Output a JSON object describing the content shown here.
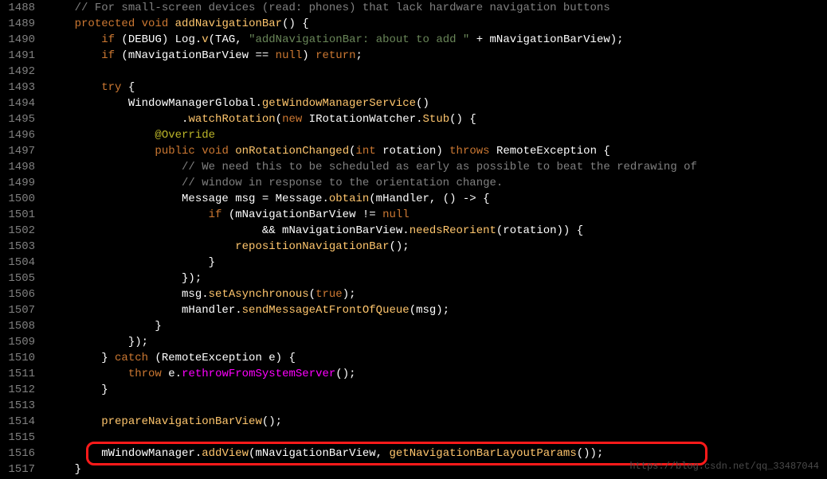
{
  "watermark": "https://blog.csdn.net/qq_33487044",
  "lines": [
    {
      "num": "1488",
      "html": "    <span class='comment'>// For small-screen devices (read: phones) that lack hardware navigation buttons</span>"
    },
    {
      "num": "1489",
      "html": "    <span class='kw-protected'>protected</span> <span class='kw-void'>void</span> <span class='method'>addNavigationBar</span>() {"
    },
    {
      "num": "1490",
      "html": "        <span class='kw-if'>if</span> (DEBUG) Log.<span class='method'>v</span>(TAG, <span class='string'>\"addNavigationBar: about to add \"</span> + mNavigationBarView);"
    },
    {
      "num": "1491",
      "html": "        <span class='kw-if'>if</span> (mNavigationBarView == <span class='lit-null'>null</span>) <span class='kw-return'>return</span>;"
    },
    {
      "num": "1492",
      "html": ""
    },
    {
      "num": "1493",
      "html": "        <span class='kw-try'>try</span> {"
    },
    {
      "num": "1494",
      "html": "            WindowManagerGlobal.<span class='method'>getWindowManagerService</span>()"
    },
    {
      "num": "1495",
      "html": "                    .<span class='method'>watchRotation</span>(<span class='kw-new'>new</span> IRotationWatcher.<span class='method'>Stub</span>() {"
    },
    {
      "num": "1496",
      "html": "                <span class='annotation'>@Override</span>"
    },
    {
      "num": "1497",
      "html": "                <span class='kw-public'>public</span> <span class='kw-void'>void</span> <span class='method'>onRotationChanged</span>(<span class='kw-int'>int</span> rotation) <span class='kw-throws'>throws</span> RemoteException {"
    },
    {
      "num": "1498",
      "html": "                    <span class='comment'>// We need this to be scheduled as early as possible to beat the redrawing of</span>"
    },
    {
      "num": "1499",
      "html": "                    <span class='comment'>// window in response to the orientation change.</span>"
    },
    {
      "num": "1500",
      "html": "                    Message msg = Message.<span class='method'>obtain</span>(mHandler, () -> {"
    },
    {
      "num": "1501",
      "html": "                        <span class='kw-if'>if</span> (mNavigationBarView != <span class='lit-null'>null</span>"
    },
    {
      "num": "1502",
      "html": "                                && mNavigationBarView.<span class='method'>needsReorient</span>(rotation)) {"
    },
    {
      "num": "1503",
      "html": "                            <span class='method'>repositionNavigationBar</span>();"
    },
    {
      "num": "1504",
      "html": "                        }"
    },
    {
      "num": "1505",
      "html": "                    });"
    },
    {
      "num": "1506",
      "html": "                    msg.<span class='method'>setAsynchronous</span>(<span class='lit-true'>true</span>);"
    },
    {
      "num": "1507",
      "html": "                    mHandler.<span class='method'>sendMessageAtFrontOfQueue</span>(msg);"
    },
    {
      "num": "1508",
      "html": "                }"
    },
    {
      "num": "1509",
      "html": "            });"
    },
    {
      "num": "1510",
      "html": "        } <span class='kw-catch'>catch</span> (RemoteException e) {"
    },
    {
      "num": "1511",
      "html": "            <span class='kw-throw'>throw</span> e.<span class='pink'>rethrowFromSystemServer</span>();"
    },
    {
      "num": "1512",
      "html": "        }"
    },
    {
      "num": "1513",
      "html": ""
    },
    {
      "num": "1514",
      "html": "        <span class='method'>prepareNavigationBarView</span>();"
    },
    {
      "num": "1515",
      "html": ""
    },
    {
      "num": "1516",
      "html": "        mWindowManager.<span class='method'>addView</span>(mNavigationBarView, <span class='method'>getNavigationBarLayoutParams</span>());"
    },
    {
      "num": "1517",
      "html": "    }"
    }
  ]
}
